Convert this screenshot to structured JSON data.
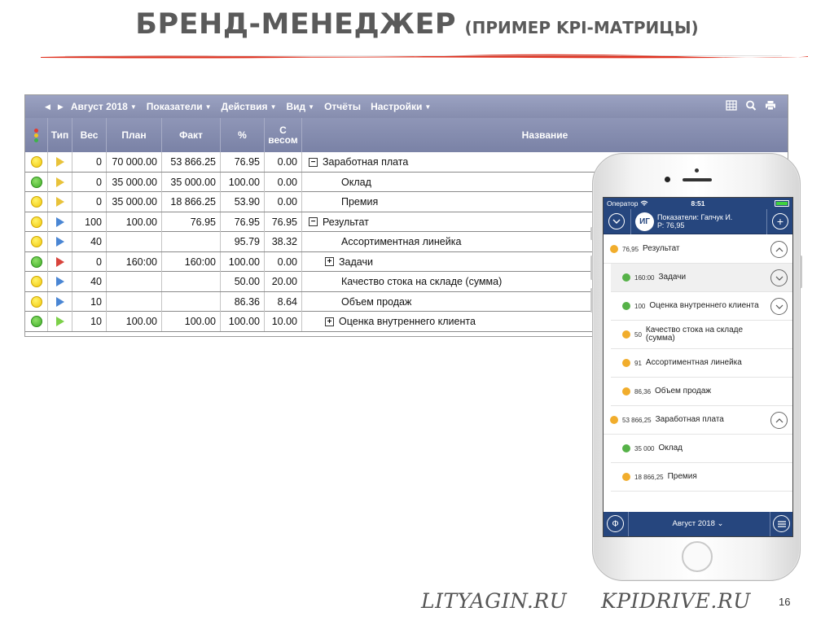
{
  "slide": {
    "title_main": "БРЕНД-МЕНЕДЖЕР",
    "title_sub": "(ПРИМЕР KPI-МАТРИЦЫ)",
    "site1": "LITYAGIN.RU",
    "site2": "KPIDRIVE.RU",
    "page_number": "16",
    "accent_color": "#e0301e"
  },
  "toolbar": {
    "period": "Август 2018",
    "menu": [
      "Показатели",
      "Действия",
      "Вид",
      "Отчёты",
      "Настройки"
    ],
    "tools": [
      "table-icon",
      "search-icon",
      "print-icon"
    ]
  },
  "table": {
    "headers": {
      "type": "Тип",
      "weight": "Вес",
      "plan": "План",
      "fact": "Факт",
      "percent": "%",
      "weighted_1": "С",
      "weighted_2": "весом",
      "name": "Название"
    },
    "rows": [
      {
        "status": "yellow",
        "type": "yellow",
        "weight": "0",
        "plan": "70 000.00",
        "fact": "53 866.25",
        "percent": "76.95",
        "weighted": "0.00",
        "tree": "−",
        "name": "Заработная плата"
      },
      {
        "status": "green",
        "type": "yellow",
        "weight": "0",
        "plan": "35 000.00",
        "fact": "35 000.00",
        "percent": "100.00",
        "weighted": "0.00",
        "tree": "",
        "name": "Оклад"
      },
      {
        "status": "yellow",
        "type": "yellow",
        "weight": "0",
        "plan": "35 000.00",
        "fact": "18 866.25",
        "percent": "53.90",
        "weighted": "0.00",
        "tree": "",
        "name": "Премия"
      },
      {
        "status": "yellow",
        "type": "blue",
        "weight": "100",
        "plan": "100.00",
        "fact": "76.95",
        "percent": "76.95",
        "weighted": "76.95",
        "tree": "−",
        "name": "Результат"
      },
      {
        "status": "yellow",
        "type": "blue",
        "weight": "40",
        "plan": "",
        "fact": "",
        "percent": "95.79",
        "weighted": "38.32",
        "tree": "",
        "name": "Ассортиментная линейка"
      },
      {
        "status": "green",
        "type": "red",
        "weight": "0",
        "plan": "160:00",
        "fact": "160:00",
        "percent": "100.00",
        "weighted": "0.00",
        "tree": "+",
        "name": "Задачи"
      },
      {
        "status": "yellow",
        "type": "blue",
        "weight": "40",
        "plan": "",
        "fact": "",
        "percent": "50.00",
        "weighted": "20.00",
        "tree": "",
        "name": "Качество стока на складе (сумма)"
      },
      {
        "status": "yellow",
        "type": "blue",
        "weight": "10",
        "plan": "",
        "fact": "",
        "percent": "86.36",
        "weighted": "8.64",
        "tree": "",
        "name": "Объем продаж"
      },
      {
        "status": "green",
        "type": "green",
        "weight": "10",
        "plan": "100.00",
        "fact": "100.00",
        "percent": "100.00",
        "weighted": "10.00",
        "tree": "+",
        "name": "Оценка внутреннего клиента"
      }
    ]
  },
  "mobile": {
    "carrier": "Оператор",
    "time": "8:51",
    "avatar": "ИГ",
    "nav_line1": "Показатели: Гапчук И.",
    "nav_line2": "Р: 76,95",
    "items": [
      {
        "dot": "y",
        "value": "76,95",
        "label": "Результат",
        "chevron": "up",
        "indent": false,
        "highlight": false
      },
      {
        "dot": "g",
        "value": "160:00",
        "label": "Задачи",
        "chevron": "down",
        "indent": true,
        "highlight": true
      },
      {
        "dot": "g",
        "value": "100",
        "label": "Оценка внутреннего клиента",
        "chevron": "down",
        "indent": true,
        "highlight": false
      },
      {
        "dot": "y",
        "value": "50",
        "label": "Качество стока на складе (сумма)",
        "chevron": "",
        "indent": true,
        "highlight": false
      },
      {
        "dot": "y",
        "value": "91",
        "label": "Ассортиментная линейка",
        "chevron": "",
        "indent": true,
        "highlight": false
      },
      {
        "dot": "y",
        "value": "86,36",
        "label": "Объем продаж",
        "chevron": "",
        "indent": true,
        "highlight": false
      },
      {
        "dot": "y",
        "value": "53 866,25",
        "label": "Заработная плата",
        "chevron": "up",
        "indent": false,
        "highlight": false
      },
      {
        "dot": "g",
        "value": "35 000",
        "label": "Оклад",
        "chevron": "",
        "indent": true,
        "highlight": false
      },
      {
        "dot": "y",
        "value": "18 866,25",
        "label": "Премия",
        "chevron": "",
        "indent": true,
        "highlight": false
      }
    ],
    "footer_period": "Август 2018 ⌄",
    "footer_left_icon": "Ф",
    "footer_right_icon": "menu-icon"
  }
}
